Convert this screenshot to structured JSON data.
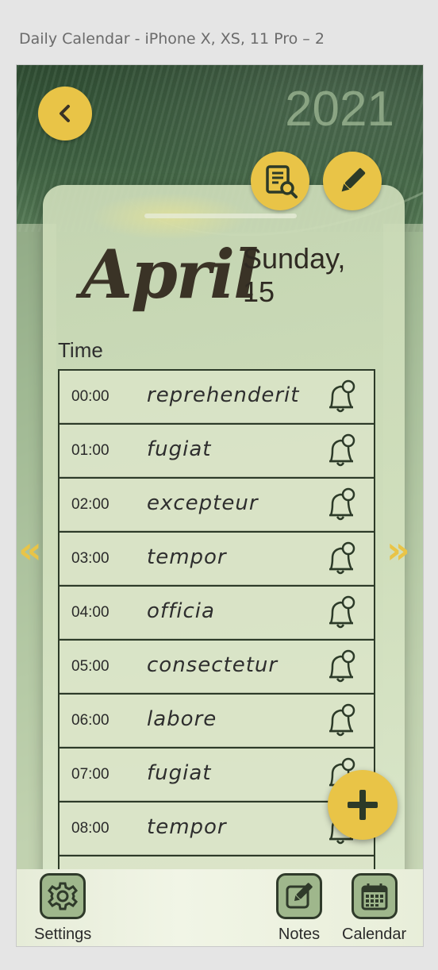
{
  "frame_title": "Daily Calendar - iPhone X, XS, 11 Pro – 2",
  "header": {
    "year": "2021",
    "back_icon": "chevron-left-icon",
    "search_notes_icon": "document-search-icon",
    "edit_icon": "pencil-icon"
  },
  "date": {
    "month": "April",
    "weekday": "Sunday,",
    "day": "15"
  },
  "time_label": "Time",
  "rows": [
    {
      "hour": "00:00",
      "task": "reprehenderit"
    },
    {
      "hour": "01:00",
      "task": "fugiat"
    },
    {
      "hour": "02:00",
      "task": "excepteur"
    },
    {
      "hour": "03:00",
      "task": "tempor"
    },
    {
      "hour": "04:00",
      "task": "officia"
    },
    {
      "hour": "05:00",
      "task": "consectetur"
    },
    {
      "hour": "06:00",
      "task": "labore"
    },
    {
      "hour": "07:00",
      "task": "fugiat"
    },
    {
      "hour": "08:00",
      "task": "tempor"
    }
  ],
  "nav": {
    "prev": "«",
    "next": "»"
  },
  "fab_icon": "plus-icon",
  "bottom_tabs": {
    "settings": "Settings",
    "notes": "Notes",
    "calendar": "Calendar"
  },
  "colors": {
    "accent": "#e9c447",
    "ink": "#2c3a28"
  }
}
